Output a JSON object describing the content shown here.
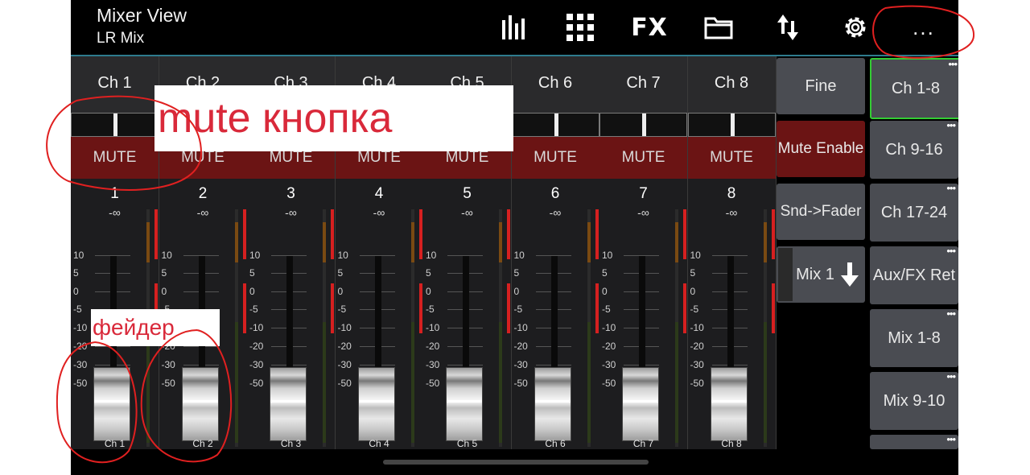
{
  "header": {
    "title": "Mixer View",
    "subtitle": "LR Mix",
    "icons": [
      "levels-icon",
      "grid-icon",
      "fx",
      "folder-icon",
      "transfer-icon",
      "gear-icon",
      "more-icon"
    ],
    "fx_label": "FX",
    "more_label": "..."
  },
  "channels": [
    {
      "name": "Ch 1",
      "mute": "MUTE",
      "number": "1",
      "level": "-∞",
      "fader_label": "Ch 1"
    },
    {
      "name": "Ch 2",
      "mute": "MUTE",
      "number": "2",
      "level": "-∞",
      "fader_label": "Ch 2"
    },
    {
      "name": "Ch 3",
      "mute": "MUTE",
      "number": "3",
      "level": "-∞",
      "fader_label": "Ch 3"
    },
    {
      "name": "Ch 4",
      "mute": "MUTE",
      "number": "4",
      "level": "-∞",
      "fader_label": "Ch 4"
    },
    {
      "name": "Ch 5",
      "mute": "MUTE",
      "number": "5",
      "level": "-∞",
      "fader_label": "Ch 5"
    },
    {
      "name": "Ch 6",
      "mute": "MUTE",
      "number": "6",
      "level": "-∞",
      "fader_label": "Ch 6"
    },
    {
      "name": "Ch 7",
      "mute": "MUTE",
      "number": "7",
      "level": "-∞",
      "fader_label": "Ch 7"
    },
    {
      "name": "Ch 8",
      "mute": "MUTE",
      "number": "8",
      "level": "-∞",
      "fader_label": "Ch 8"
    }
  ],
  "fader_scale": [
    "10",
    "5",
    "0",
    "-5",
    "-10",
    "-20",
    "-30",
    "-50"
  ],
  "controls": {
    "fine": "Fine",
    "mute_enable": "Mute Enable",
    "snd_fader": "Snd->Fader",
    "mix": "Mix 1"
  },
  "banks": [
    {
      "label": "Ch 1-8",
      "selected": true
    },
    {
      "label": "Ch 9-16",
      "selected": false
    },
    {
      "label": "Ch 17-24",
      "selected": false
    },
    {
      "label": "Aux/FX Ret",
      "selected": false
    },
    {
      "label": "Mix 1-8",
      "selected": false
    },
    {
      "label": "Mix 9-10",
      "selected": false
    }
  ],
  "bank_more": "•••",
  "annotations": {
    "mute": "mute кнопка",
    "fader": "фейдер"
  },
  "colors": {
    "mute_bg": "#6b1414",
    "accent_line": "#2e7b8e",
    "selected_bank_border": "#33cc33",
    "annotation": "#d9293a"
  }
}
